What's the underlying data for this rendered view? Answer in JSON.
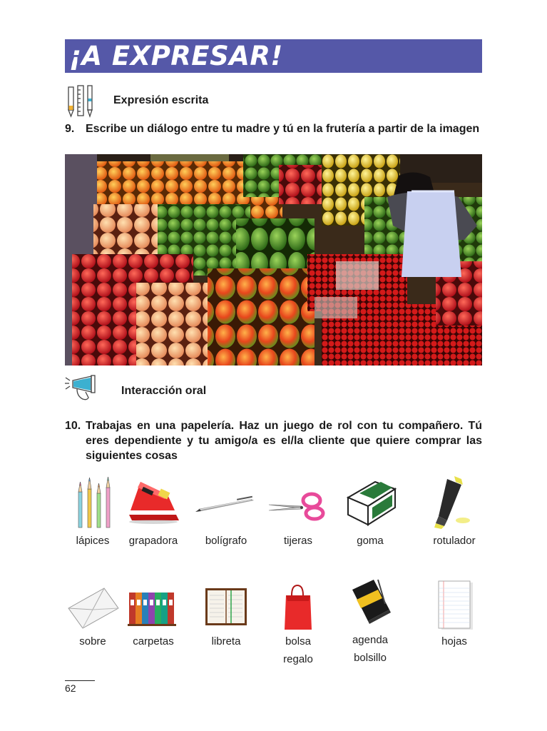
{
  "header": {
    "title": "¡A EXPRESAR!"
  },
  "section_writing": {
    "label": "Expresión escrita",
    "icon": "pencils-icon"
  },
  "exercise9": {
    "number": "9.",
    "text": "Escribe un diálogo entre tu madre y tú en la frutería a partir de la imagen"
  },
  "section_oral": {
    "label": "Interacción oral",
    "icon": "megaphone-icon"
  },
  "exercise10": {
    "number": "10.",
    "text": "Trabajas en una papelería. Haz un juego de rol con tu compañero. Tú eres dependiente y tu amigo/a es el/la cliente que quiere comprar las siguientes cosas"
  },
  "items_row1": [
    {
      "label": "lápices",
      "icon": "colored-pencils-icon"
    },
    {
      "label": "grapadora",
      "icon": "stapler-icon"
    },
    {
      "label": "bolígrafo",
      "icon": "pen-icon"
    },
    {
      "label": "tijeras",
      "icon": "scissors-icon"
    },
    {
      "label": "goma",
      "icon": "eraser-icon"
    },
    {
      "label": "rotulador",
      "icon": "highlighter-icon"
    }
  ],
  "items_row2": [
    {
      "label": "sobre",
      "icon": "envelope-icon"
    },
    {
      "label": "carpetas",
      "icon": "binders-icon"
    },
    {
      "label": "libreta",
      "icon": "notebook-icon"
    },
    {
      "label_line1": "bolsa",
      "label_line2": "regalo",
      "icon": "gift-bag-icon"
    },
    {
      "label_line1": "agenda",
      "label_line2": "bolsillo",
      "icon": "pocket-agenda-icon"
    },
    {
      "label": "hojas",
      "icon": "paper-sheets-icon"
    }
  ],
  "footer": {
    "page_number": "62"
  },
  "colors": {
    "banner": "#5558a8"
  }
}
